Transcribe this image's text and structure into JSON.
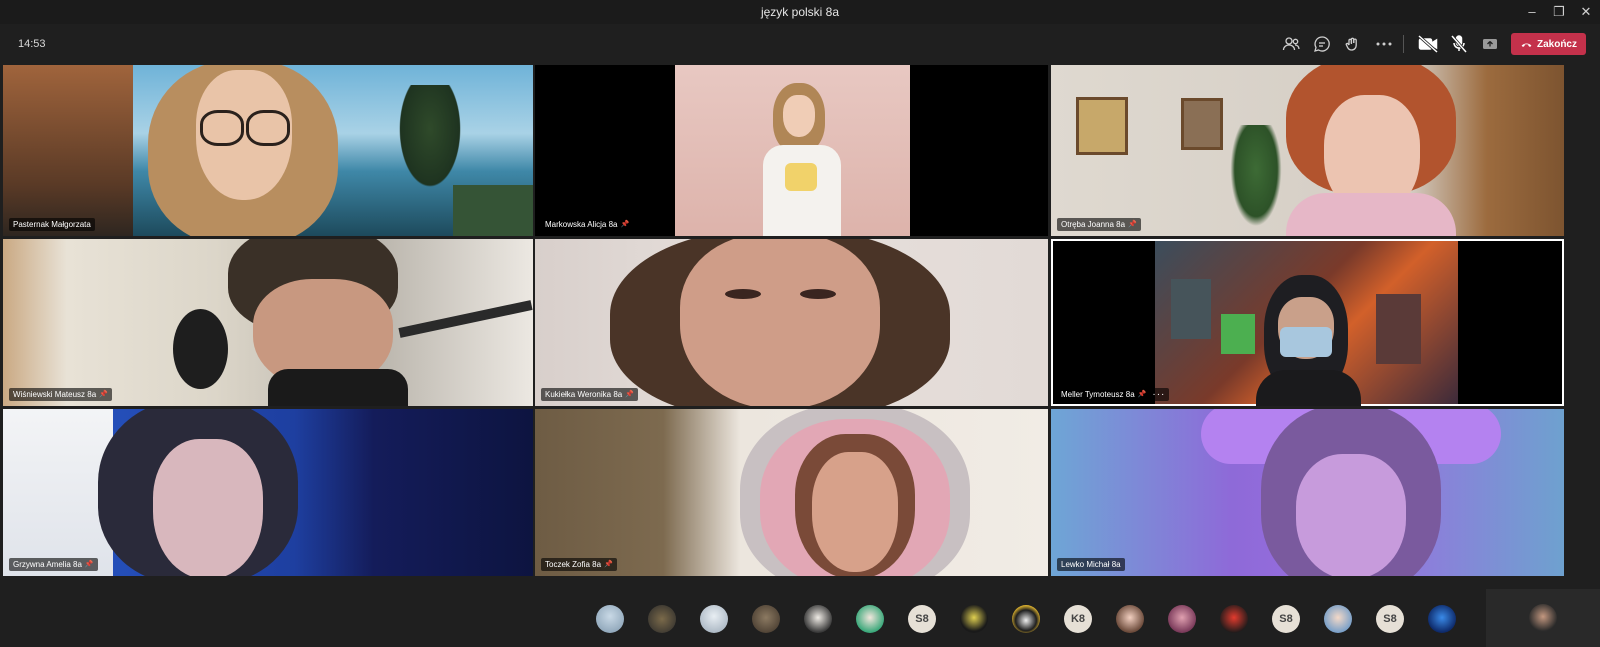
{
  "window": {
    "title": "język polski 8a",
    "controls": [
      "minimize-icon",
      "restore-icon",
      "close-icon"
    ]
  },
  "toolbar": {
    "time": "14:53",
    "icons": [
      "participants-icon",
      "chat-icon",
      "reactions-icon",
      "more-actions-icon",
      "camera-off-icon",
      "mic-off-icon",
      "share-screen-icon"
    ],
    "hangup_label": "Zakończ",
    "hangup_color": "#c4314b"
  },
  "participants": [
    {
      "name": "Pasternak Małgorzata",
      "pinned": false
    },
    {
      "name": "Markowska Alicja 8a",
      "pinned": true
    },
    {
      "name": "Otręba Joanna 8a",
      "pinned": true
    },
    {
      "name": "Wiśniewski Mateusz 8a",
      "pinned": true
    },
    {
      "name": "Kukiełka Weronika 8a",
      "pinned": true
    },
    {
      "name": "Meller Tymoteusz 8a",
      "pinned": true,
      "more": "···"
    },
    {
      "name": "Grzywna Amelia 8a",
      "pinned": true
    },
    {
      "name": "Toczek Zofia 8a",
      "pinned": true
    },
    {
      "name": "Lewko Michał 8a",
      "pinned": false
    }
  ],
  "roster": {
    "initials": [
      "S8",
      "K8",
      "S8",
      "S8"
    ]
  },
  "colors": {
    "active_speaker_border": "#ffffff",
    "background": "#1f1f1f"
  }
}
